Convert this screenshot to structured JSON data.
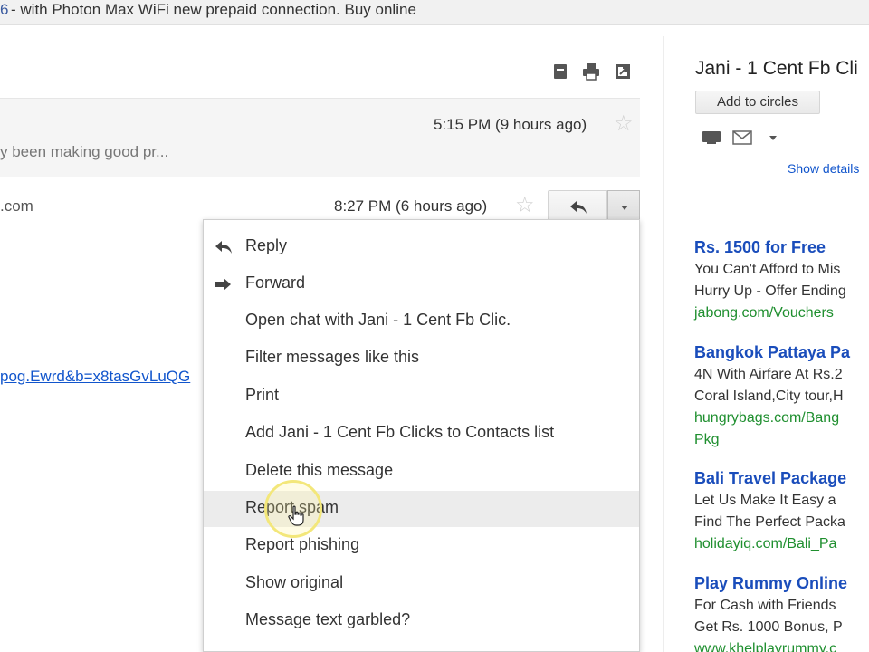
{
  "banner": {
    "link_text": "6",
    "text": " - with Photon Max WiFi new prepaid connection. Buy online"
  },
  "toolbar": {
    "icons": [
      "archive-icon",
      "print-icon",
      "new-window-icon"
    ]
  },
  "thread": {
    "message1": {
      "time": "5:15 PM (9 hours ago)",
      "snippet": "y been making good pr..."
    },
    "message2": {
      "sender_fragment": ".com",
      "time": "8:27 PM (6 hours ago)",
      "link_fragment": "pog.Ewrd&b=x8tasGvLuQG"
    }
  },
  "menu": {
    "items": [
      {
        "label": "Reply",
        "icon": "reply-icon"
      },
      {
        "label": "Forward",
        "icon": "forward-icon"
      },
      {
        "label": "Open chat with Jani - 1 Cent Fb Clic."
      },
      {
        "label": "Filter messages like this"
      },
      {
        "label": "Print"
      },
      {
        "label": "Add Jani - 1 Cent Fb Clicks to Contacts list"
      },
      {
        "label": "Delete this message"
      },
      {
        "label": "Report spam",
        "highlighted": true
      },
      {
        "label": "Report phishing"
      },
      {
        "label": "Show original"
      },
      {
        "label": "Message text garbled?"
      }
    ]
  },
  "sidebar": {
    "contact_name": "Jani - 1 Cent Fb Cli",
    "add_to_circles": "Add to circles",
    "show_details": "Show details",
    "ads": [
      {
        "title": "Rs. 1500 for Free",
        "lines": [
          "You Can't Afford to Mis",
          "Hurry Up - Offer Ending"
        ],
        "url": "jabong.com/Vouchers"
      },
      {
        "title": "Bangkok Pattaya Pa",
        "lines": [
          "4N With Airfare At Rs.2",
          "Coral Island,City tour,H"
        ],
        "url": "hungrybags.com/Bang",
        "url2": "Pkg"
      },
      {
        "title": "Bali Travel Package",
        "lines": [
          "Let Us Make It Easy a",
          "Find The Perfect Packa"
        ],
        "url": "holidayiq.com/Bali_Pa"
      },
      {
        "title": "Play Rummy Online",
        "lines": [
          "For Cash with Friends",
          "Get Rs. 1000 Bonus, P"
        ],
        "url": "www.khelplayrummy.c"
      }
    ]
  },
  "colors": {
    "link_blue": "#1155cc",
    "ad_title": "#1a4dbb",
    "ad_url": "#1f8f2f",
    "menu_hover": "#ececec"
  }
}
